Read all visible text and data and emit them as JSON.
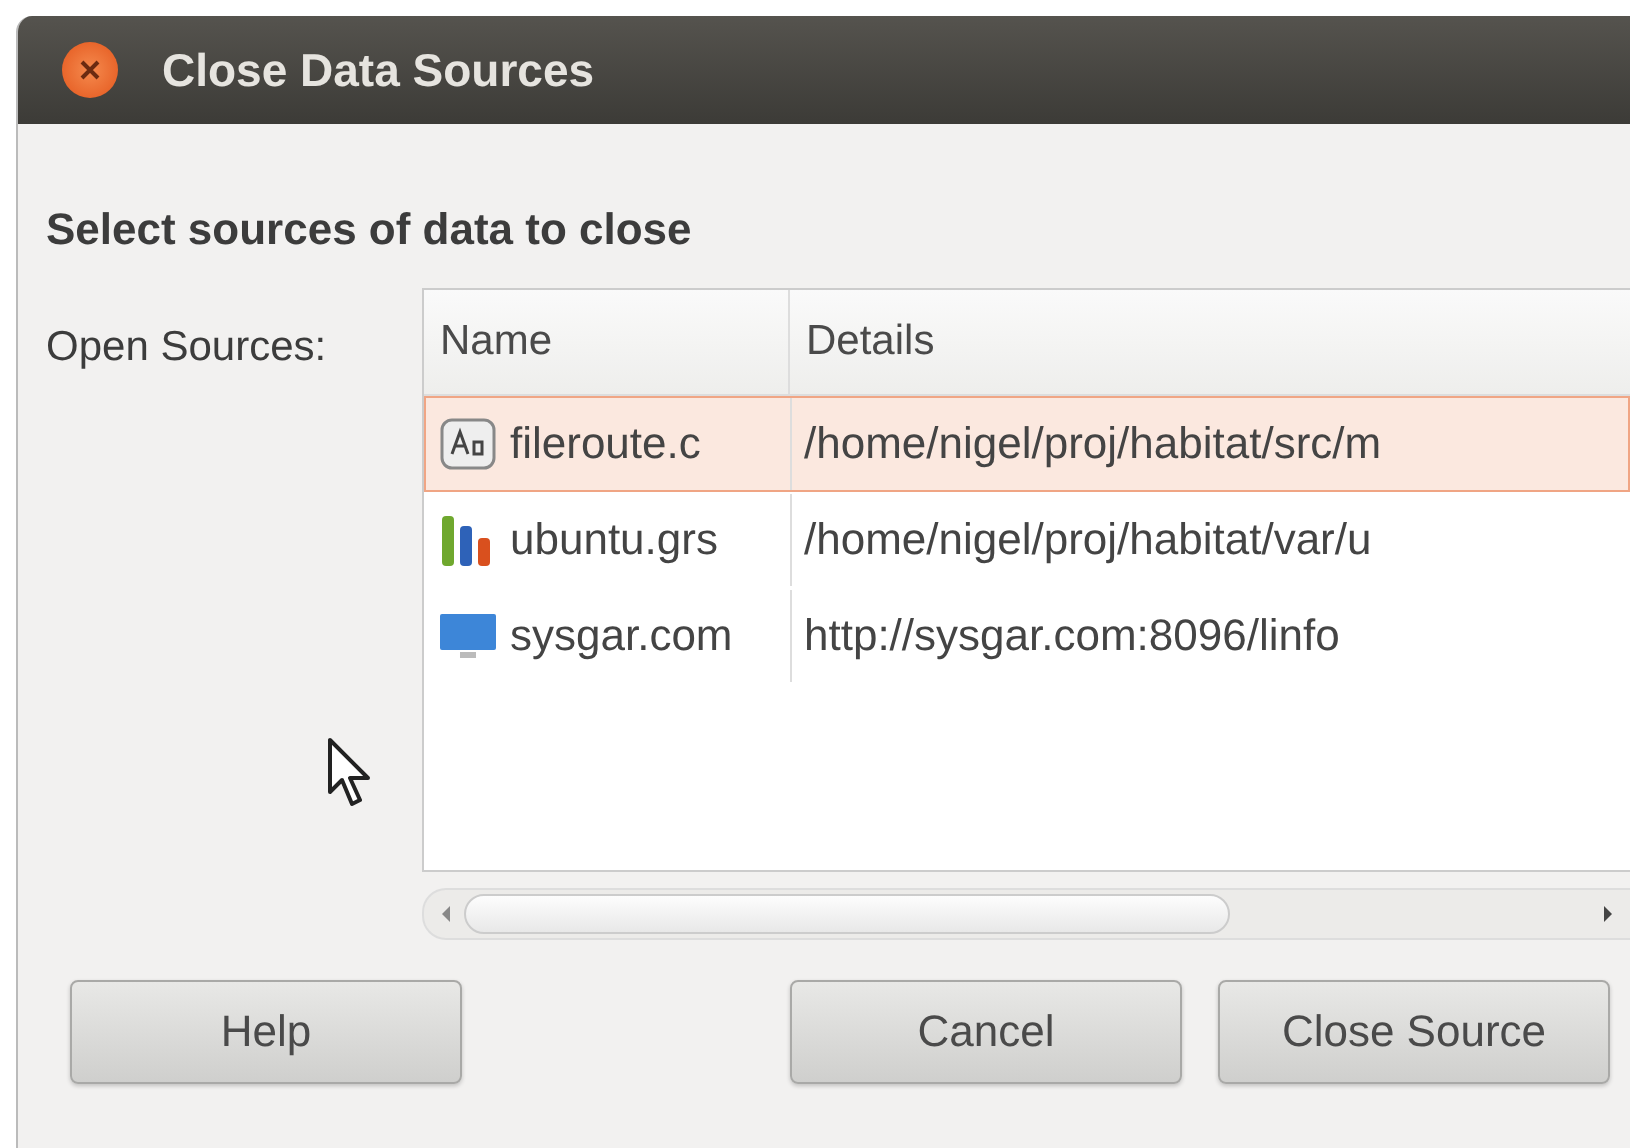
{
  "window": {
    "title": "Close Data Sources"
  },
  "heading": "Select sources of data to close",
  "sources_label": "Open Sources:",
  "table": {
    "columns": [
      "Name",
      "Details"
    ],
    "rows": [
      {
        "kind": "font",
        "name": "fileroute.c",
        "details": "/home/nigel/proj/habitat/src/m",
        "selected": true
      },
      {
        "kind": "chart",
        "name": "ubuntu.grs",
        "details": "/home/nigel/proj/habitat/var/u",
        "selected": false
      },
      {
        "kind": "monitor",
        "name": "sysgar.com",
        "details": "http://sysgar.com:8096/linfo",
        "selected": false
      }
    ]
  },
  "buttons": [
    "Help",
    "Cancel",
    "Close Source"
  ]
}
